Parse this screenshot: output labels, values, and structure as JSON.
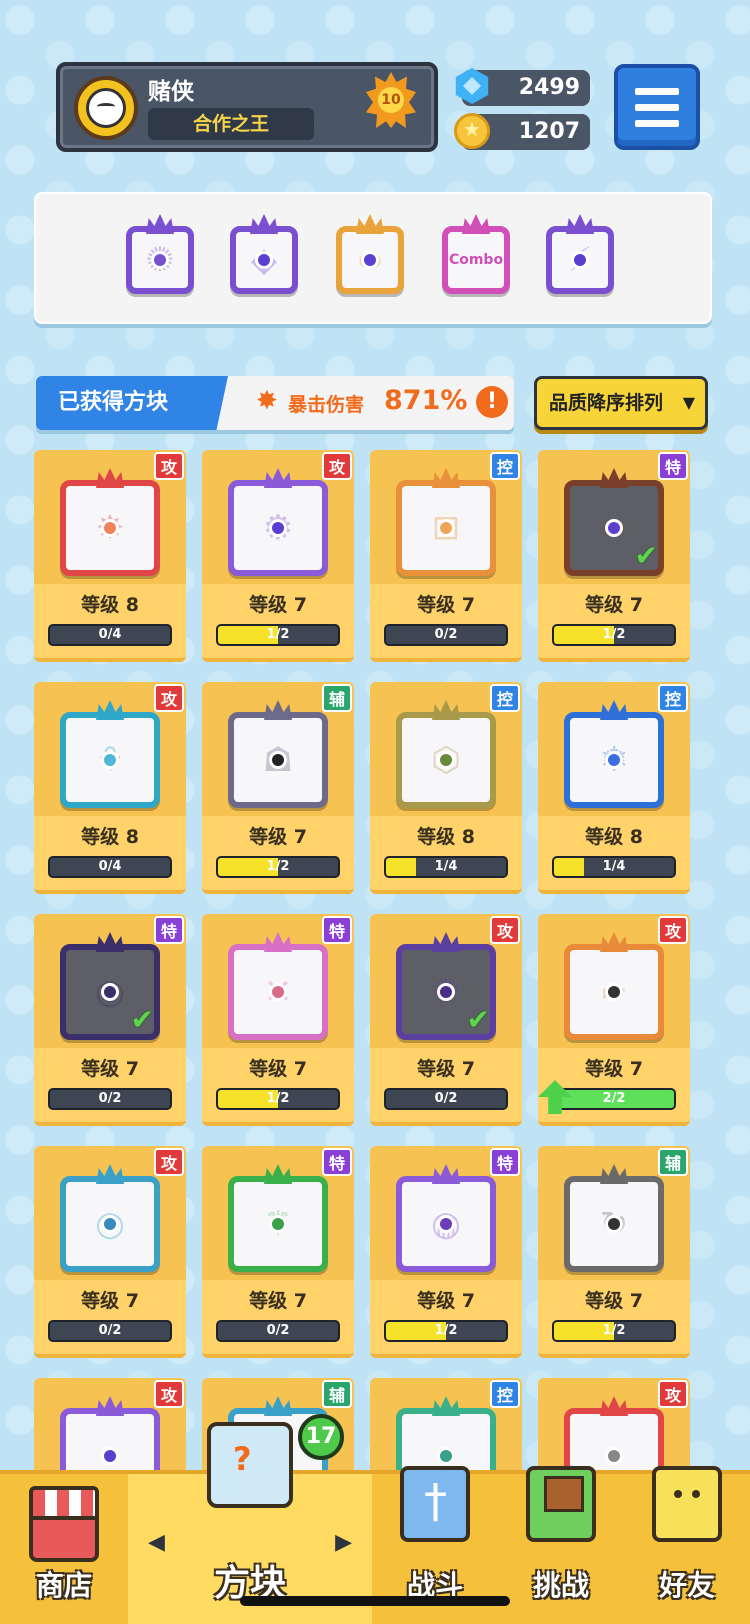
{
  "player": {
    "name": "赌侠",
    "title": "合作之王",
    "level": "10"
  },
  "currency": {
    "gems": "2499",
    "coins": "1207"
  },
  "equipped": [
    {
      "color": "#7a4fd0",
      "dot": "#7a4fd0",
      "glyph": "✺",
      "icon": "orbit-icon"
    },
    {
      "color": "#7a4fd0",
      "dot": "#5a3fd0",
      "glyph": "◆",
      "icon": "diamond-icon"
    },
    {
      "color": "#e8a33a",
      "dot": "#5a3fd0",
      "glyph": "∞",
      "icon": "infinity-icon",
      "text": ""
    },
    {
      "color": "#d14fb8",
      "dot": "#d14fb8",
      "glyph": "",
      "icon": "combo-icon",
      "text": "Combo"
    },
    {
      "color": "#7a4fd0",
      "dot": "#5a3fd0",
      "glyph": "⚡",
      "icon": "crack-icon"
    }
  ],
  "owned": {
    "label": "已获得方块",
    "crit_label": "暴击伤害",
    "crit_value": "871%",
    "info": "!"
  },
  "sort": {
    "label": "品质降序排列",
    "caret": "▼"
  },
  "type_labels": {
    "atk": "攻",
    "ctl": "控",
    "spc": "特",
    "sup": "辅"
  },
  "cards": [
    {
      "type": "atk",
      "level": "等级 8",
      "progress": "0/4",
      "fill": 0,
      "color": "#e04646",
      "dot": "#f0835a",
      "glyph": "✸",
      "icon": "burst-icon"
    },
    {
      "type": "atk",
      "level": "等级 7",
      "progress": "1/2",
      "fill": 0.5,
      "color": "#8a5ad8",
      "dot": "#5a3fd0",
      "glyph": "⚙",
      "icon": "gear-icon"
    },
    {
      "type": "ctl",
      "level": "等级 7",
      "progress": "0/2",
      "fill": 0,
      "color": "#e8913a",
      "dot": "#f0a35a",
      "glyph": "⊞",
      "icon": "box-icon"
    },
    {
      "type": "spc",
      "level": "等级 7",
      "progress": "1/2",
      "fill": 0.5,
      "color": "#7a3f2a",
      "dot": "#5a3fd0",
      "glyph": "∞",
      "icon": "infinity-icon",
      "dark": true,
      "check": true
    },
    {
      "type": "atk",
      "level": "等级 8",
      "progress": "0/4",
      "fill": 0,
      "color": "#2fa7c9",
      "dot": "#4fb8d8",
      "glyph": "⚘",
      "icon": "trident-icon"
    },
    {
      "type": "sup",
      "level": "等级 7",
      "progress": "1/2",
      "fill": 0.5,
      "color": "#6d6a8a",
      "dot": "#222",
      "glyph": "☗",
      "icon": "jaw-icon"
    },
    {
      "type": "ctl",
      "level": "等级 8",
      "progress": "1/4",
      "fill": 0.25,
      "color": "#a89a4a",
      "dot": "#6a8a3a",
      "glyph": "⬡",
      "icon": "hex-icon"
    },
    {
      "type": "ctl",
      "level": "等级 8",
      "progress": "1/4",
      "fill": 0.25,
      "color": "#2f6fd8",
      "dot": "#3a6fe0",
      "glyph": "❄",
      "icon": "snowflake-icon"
    },
    {
      "type": "spc",
      "level": "等级 7",
      "progress": "0/2",
      "fill": 0,
      "color": "#3a2f6a",
      "dot": "#3a2f6a",
      "glyph": "◉",
      "icon": "target-icon",
      "dark": true,
      "check": true
    },
    {
      "type": "spc",
      "level": "等级 7",
      "progress": "1/2",
      "fill": 0.5,
      "color": "#d870c8",
      "dot": "#d86a8a",
      "glyph": "✕",
      "icon": "syringe-icon"
    },
    {
      "type": "atk",
      "level": "等级 7",
      "progress": "0/2",
      "fill": 0,
      "color": "#5a3fa0",
      "dot": "#4a2f8a",
      "glyph": "✺",
      "icon": "atom-icon",
      "dark": true,
      "check": true
    },
    {
      "type": "atk",
      "level": "等级 7",
      "progress": "2/2",
      "fill": 1,
      "color": "#e88a3a",
      "dot": "#333",
      "glyph": "⌐",
      "icon": "gun-icon",
      "upgrade": true
    },
    {
      "type": "atk",
      "level": "等级 7",
      "progress": "0/2",
      "fill": 0,
      "color": "#3aa0c8",
      "dot": "#3a8ac0",
      "glyph": "◎",
      "icon": "whirlpool-icon"
    },
    {
      "type": "spc",
      "level": "等级 7",
      "progress": "0/2",
      "fill": 0,
      "color": "#3ab04a",
      "dot": "#3aa04a",
      "glyph": "⚚",
      "icon": "vine-icon"
    },
    {
      "type": "spc",
      "level": "等级 7",
      "progress": "1/2",
      "fill": 0.5,
      "color": "#8a5ad8",
      "dot": "#6a3fb8",
      "glyph": "◍",
      "icon": "vortex-icon"
    },
    {
      "type": "sup",
      "level": "等级 7",
      "progress": "1/2",
      "fill": 0.5,
      "color": "#6a6a6a",
      "dot": "#333",
      "glyph": "↻",
      "icon": "rotate-icon"
    },
    {
      "type": "atk",
      "level": "",
      "progress": "",
      "fill": 0,
      "color": "#8a5ad8",
      "dot": "#5a3fd0",
      "glyph": "",
      "icon": "block-icon"
    },
    {
      "type": "sup",
      "level": "",
      "progress": "",
      "fill": 0,
      "color": "#3aa0c8",
      "dot": "#3a8ac0",
      "glyph": "",
      "icon": "block-icon"
    },
    {
      "type": "ctl",
      "level": "",
      "progress": "",
      "fill": 0,
      "color": "#3ab08a",
      "dot": "#3aa08a",
      "glyph": "",
      "icon": "block-icon"
    },
    {
      "type": "atk",
      "level": "",
      "progress": "",
      "fill": 0,
      "color": "#e04646",
      "dot": "#888",
      "glyph": "",
      "icon": "saw-icon"
    }
  ],
  "nav": {
    "shop": "商店",
    "blocks": "方块",
    "battle": "战斗",
    "challenge": "挑战",
    "friends": "好友",
    "blocks_badge": "17",
    "arrow_left": "◀",
    "arrow_right": "▶"
  }
}
